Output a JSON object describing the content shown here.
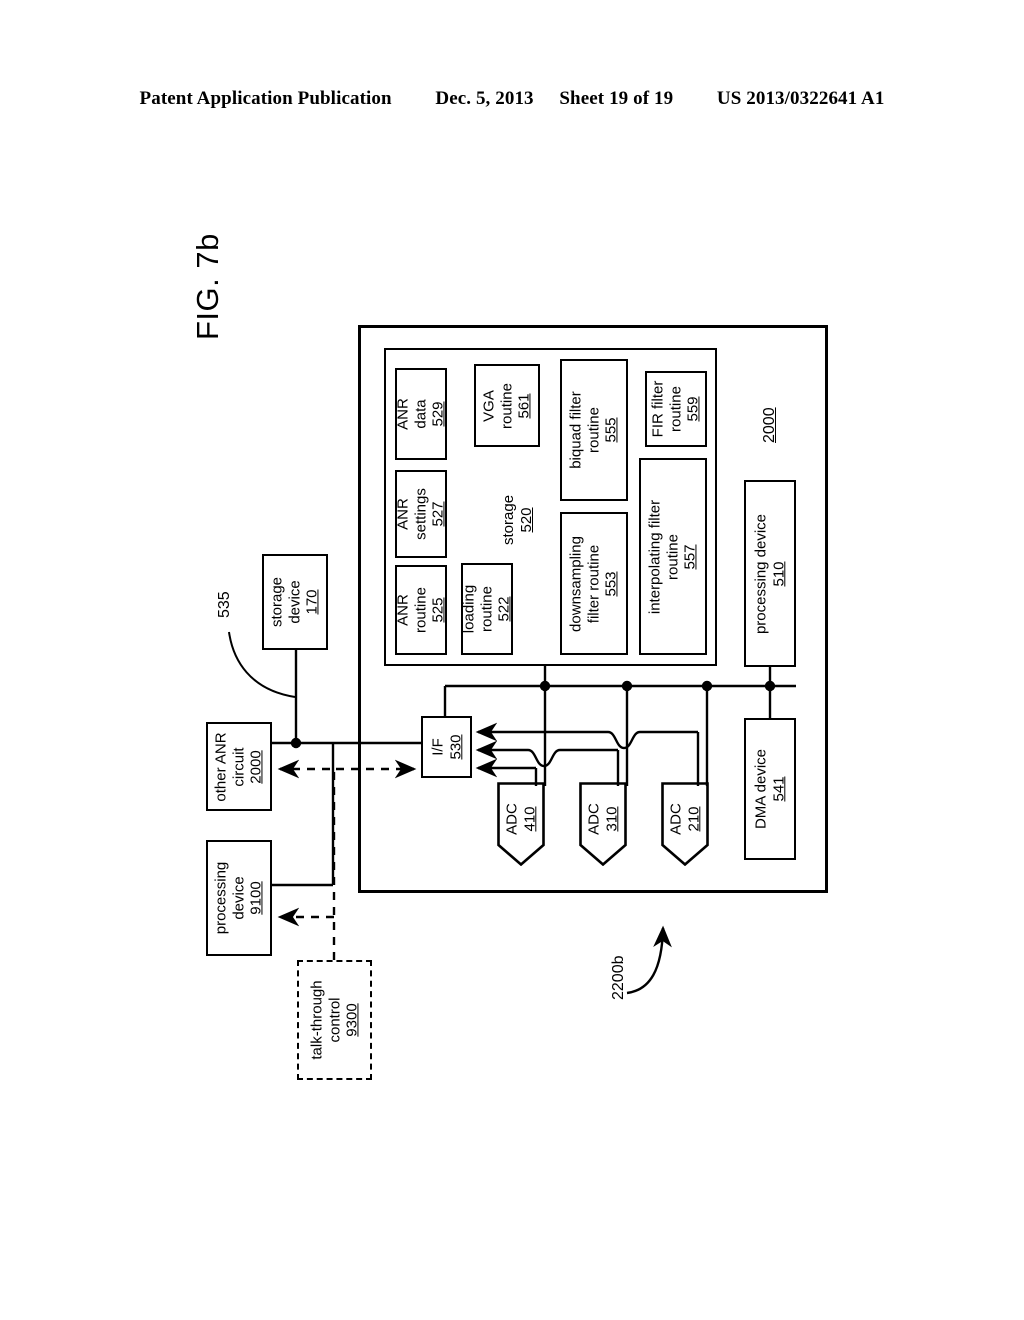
{
  "header": {
    "publication": "Patent Application Publication",
    "date": "Dec. 5, 2013",
    "sheet": "Sheet 19 of 19",
    "docnum": "US 2013/0322641 A1"
  },
  "figure": {
    "label": "FIG. 7b",
    "system_ref": "2200b",
    "lead_535": "535",
    "outer_ref": "2000"
  },
  "storage_block": {
    "title": "storage",
    "num": "520"
  },
  "blocks": {
    "anr_routine": {
      "line1": "ANR",
      "line2": "routine",
      "num": "525"
    },
    "anr_settings": {
      "line1": "ANR",
      "line2": "settings",
      "num": "527"
    },
    "anr_data": {
      "line1": "ANR",
      "line2": "data",
      "num": "529"
    },
    "loading_routine": {
      "line1": "loading",
      "line2": "routine",
      "num": "522"
    },
    "vga_routine": {
      "line1": "VGA",
      "line2": "routine",
      "num": "561"
    },
    "downsampling_filter_routine": {
      "line1": "downsampling",
      "line2": "filter routine",
      "num": "553"
    },
    "biquad_filter_routine": {
      "line1": "biquad filter",
      "line2": "routine",
      "num": "555"
    },
    "interpolating_filter_routine": {
      "line1": "interpolating filter",
      "line2": "routine",
      "num": "557"
    },
    "fir_filter_routine": {
      "line1": "FIR filter",
      "line2": "routine",
      "num": "559"
    },
    "processing_device_510": {
      "line1": "processing device",
      "line2": "",
      "num": "510"
    },
    "dma_device": {
      "line1": "DMA device",
      "line2": "",
      "num": "541"
    },
    "interface": {
      "line1": "I/F",
      "line2": "",
      "num": "530"
    },
    "adc_410": {
      "line1": "ADC",
      "num": "410"
    },
    "adc_310": {
      "line1": "ADC",
      "num": "310"
    },
    "adc_210": {
      "line1": "ADC",
      "num": "210"
    },
    "storage_device_170": {
      "line1": "storage",
      "line2": "device",
      "num": "170"
    },
    "other_anr_circuit": {
      "line1": "other ANR",
      "line2": "circuit",
      "num": "2000"
    },
    "processing_device_9100": {
      "line1": "processing",
      "line2": "device",
      "num": "9100"
    },
    "talk_through_control": {
      "line1": "talk-through",
      "line2": "control",
      "num": "9300"
    }
  }
}
